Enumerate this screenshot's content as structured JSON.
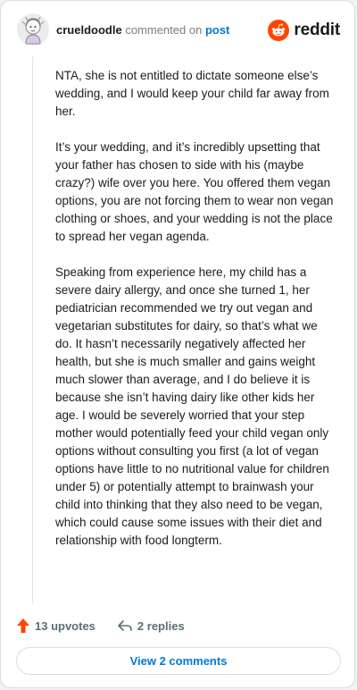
{
  "header": {
    "username": "crueldoodle",
    "action_text": "commented on",
    "target_text": "post",
    "brand_name": "reddit",
    "brand_color": "#ff4500"
  },
  "comment": {
    "paragraphs": [
      "NTA, she is not entitled to dictate someone else’s wedding, and I would keep your child far away from her.",
      "It’s your wedding, and it’s incredibly upsetting that your father has chosen to side with his (maybe crazy?) wife over you here. You offered them vegan options, you are not forcing them to wear non vegan clothing or shoes, and your wedding is not the place to spread her vegan agenda.",
      "Speaking from experience here, my child has a severe dairy allergy, and once she turned 1, her pediatrician recommended we try out vegan and vegetarian substitutes for dairy, so that’s what we do. It hasn’t necessarily negatively affected her health, but she is much smaller and gains weight much slower than average, and I do believe it is because she isn’t having dairy like other kids her age. I would be severely worried that your step mother would potentially feed your child vegan only options without consulting you first (a lot of vegan options have little to no nutritional value for children under 5) or potentially attempt to brainwash your child into thinking that they also need to be vegan, which could cause some issues with their diet and relationship with food longterm."
    ]
  },
  "actions": {
    "upvotes_label": "13 upvotes",
    "replies_label": "2 replies",
    "upvote_icon": "upvote-arrow-icon",
    "reply_icon": "reply-arrow-icon",
    "upvote_color": "#ff4500"
  },
  "footer": {
    "view_comments_label": "View 2 comments"
  }
}
